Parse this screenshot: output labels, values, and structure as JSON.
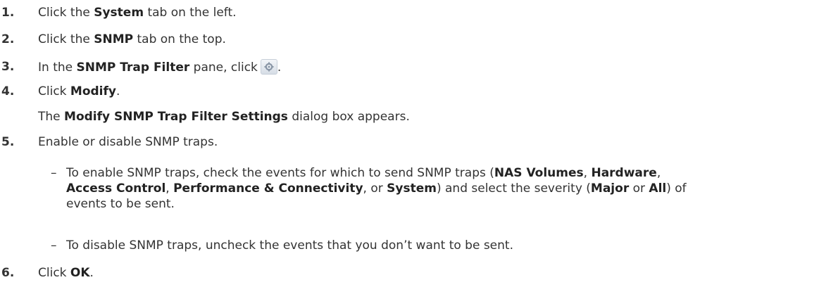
{
  "steps": [
    {
      "num": "1.",
      "pre": "Click the ",
      "bold": "System",
      "post": " tab on the left."
    },
    {
      "num": "2.",
      "pre": "Click the ",
      "bold": "SNMP",
      "post": " tab on the top."
    },
    {
      "num": "3.",
      "pre": "In the ",
      "bold": "SNMP Trap Filter",
      "post": " pane, click",
      "end": "."
    },
    {
      "num": "4.",
      "pre": "Click ",
      "bold": "Modify",
      "post": "."
    },
    {
      "num": "5.",
      "text": "Enable or disable SNMP traps."
    },
    {
      "num": "6.",
      "pre": "Click ",
      "bold": "OK",
      "post": "."
    }
  ],
  "step4_result": {
    "pre": "The ",
    "bold": "Modify SNMP Trap Filter Settings",
    "post": " dialog box appears."
  },
  "bullets": {
    "dash": "–",
    "enable": {
      "t1": "To enable SNMP traps, check the events for which to send SNMP traps (",
      "b1": "NAS Volumes",
      "s1": ", ",
      "b2": "Hardware",
      "s2": ",",
      "b3": "Access Control",
      "s3": ", ",
      "b4": "Performance & Connectivity",
      "s4": ", or ",
      "b5": "System",
      "s5": ") and select the severity (",
      "b6": "Major",
      "s6": " or ",
      "b7": "All",
      "s7": ") of",
      "t2": "events to be sent."
    },
    "disable": "To disable SNMP traps, uncheck the events that you don’t want to be sent."
  },
  "icons": {
    "step3_button": "gear-icon"
  }
}
